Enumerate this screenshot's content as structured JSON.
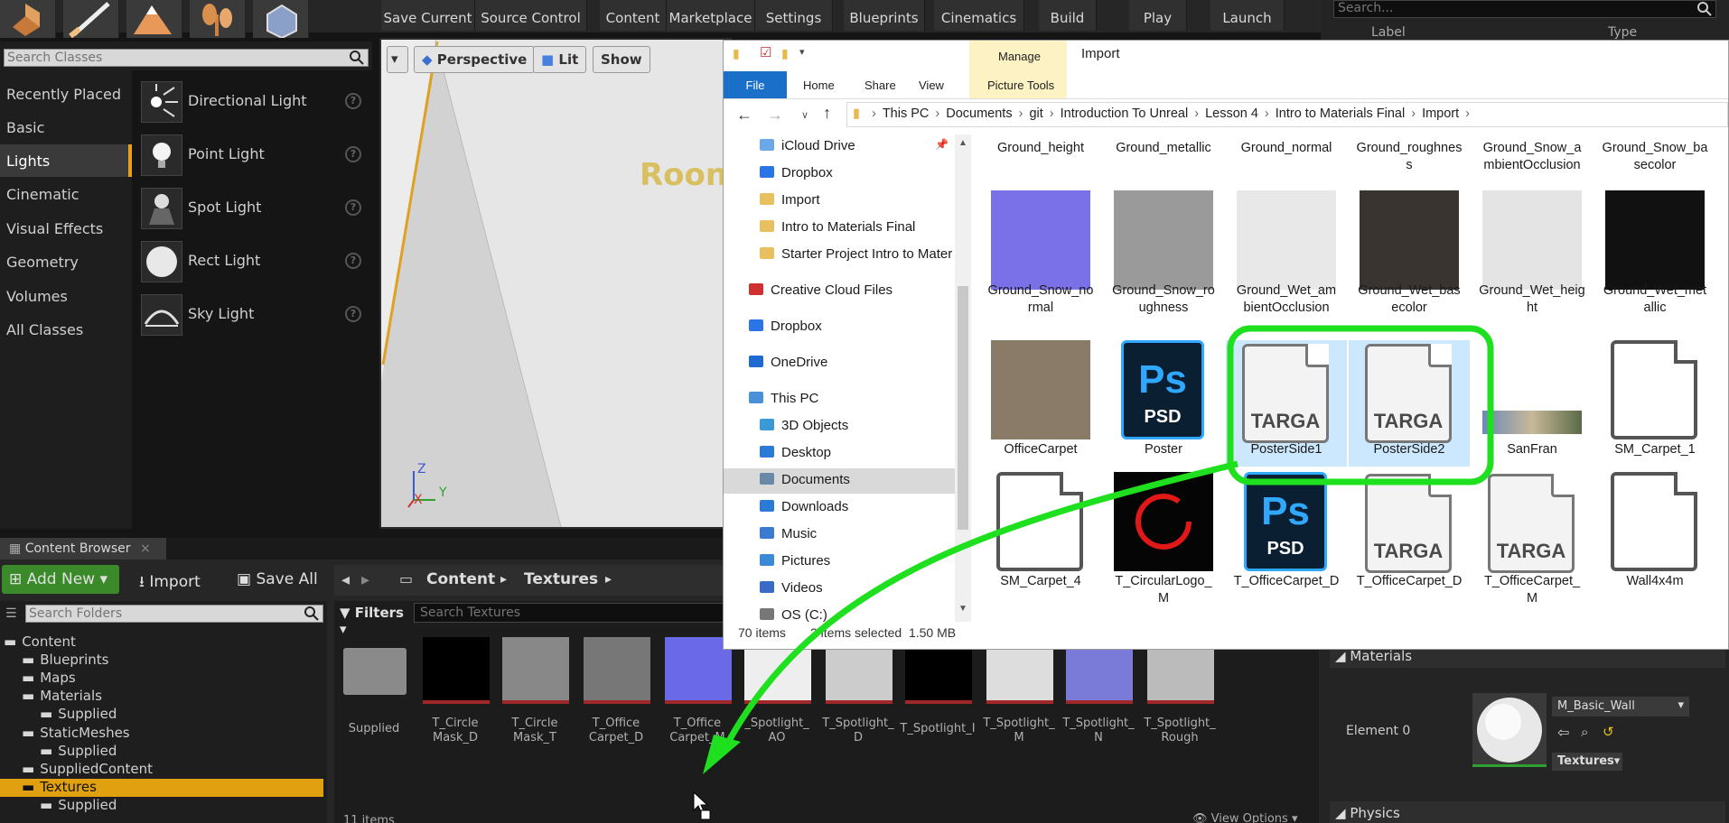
{
  "ue": {
    "toolbar": {
      "buttons": [
        "Save Current",
        "Source Control",
        "Content",
        "Marketplace",
        "Settings",
        "Blueprints",
        "Cinematics",
        "Build",
        "Play",
        "Launch"
      ]
    },
    "modes": {
      "search_placeholder": "Search Classes",
      "categories": [
        "Recently Placed",
        "Basic",
        "Lights",
        "Cinematic",
        "Visual Effects",
        "Geometry",
        "Volumes",
        "All Classes"
      ],
      "selected_category": "Lights",
      "lights": [
        "Directional Light",
        "Point Light",
        "Spot Light",
        "Rect Light",
        "Sky Light"
      ]
    },
    "viewport": {
      "perspective": "Perspective",
      "lit": "Lit",
      "show": "Show",
      "sign_text": "Roon",
      "axis_z": "Z",
      "axis_x": "X",
      "axis_y": "Y"
    },
    "content_browser": {
      "tab": "Content Browser",
      "add_new": "Add New",
      "import": "Import",
      "save_all": "Save All",
      "path": [
        "Content",
        "Textures"
      ],
      "search_folders_placeholder": "Search Folders",
      "filters": "Filters",
      "search_textures_placeholder": "Search Textures",
      "tree": [
        {
          "label": "Content",
          "depth": 0
        },
        {
          "label": "Blueprints",
          "depth": 1
        },
        {
          "label": "Maps",
          "depth": 1
        },
        {
          "label": "Materials",
          "depth": 1
        },
        {
          "label": "Supplied",
          "depth": 2
        },
        {
          "label": "StaticMeshes",
          "depth": 1
        },
        {
          "label": "Supplied",
          "depth": 2
        },
        {
          "label": "SuppliedContent",
          "depth": 1
        },
        {
          "label": "Textures",
          "depth": 1
        },
        {
          "label": "Supplied",
          "depth": 2
        }
      ],
      "selected_folder": "Textures",
      "assets": [
        "Supplied",
        "T_Circle\nMask_D",
        "T_Circle\nMask_T",
        "T_Office\nCarpet_D",
        "T_Office\nCarpet_M",
        "_Spotlight_\nAO",
        "T_Spotlight_\nD",
        "T_Spotlight_I",
        "T_Spotlight_\nM",
        "T_Spotlight_\nN",
        "T_Spotlight_\nRough"
      ],
      "item_count": "11 items",
      "view_options": "View Options"
    },
    "details": {
      "search_placeholder": "Search...",
      "col_label": "Label",
      "col_type": "Type",
      "materials_header": "Materials",
      "element_label": "Element 0",
      "material_name": "M_Basic_Wall",
      "textures_dropdown": "Textures",
      "physics_header": "Physics"
    }
  },
  "explorer": {
    "ribbon": {
      "manage": "Manage",
      "title": "Import",
      "tabs": [
        "File",
        "Home",
        "Share",
        "View"
      ],
      "picture_tools": "Picture Tools"
    },
    "breadcrumb": [
      "This PC",
      "Documents",
      "git",
      "Introduction To Unreal",
      "Lesson 4",
      "Intro to Materials Final",
      "Import"
    ],
    "nav": [
      {
        "label": "iCloud Drive",
        "indent": 1,
        "icon": "cloud-icon"
      },
      {
        "label": "Dropbox",
        "indent": 1,
        "icon": "dropbox-icon"
      },
      {
        "label": "Import",
        "indent": 1,
        "icon": "folder-icon"
      },
      {
        "label": "Intro to Materials Final",
        "indent": 1,
        "icon": "folder-icon"
      },
      {
        "label": "Starter Project Intro to Mater",
        "indent": 1,
        "icon": "folder-icon"
      },
      {
        "label": "Creative Cloud Files",
        "indent": 0,
        "icon": "creative-cloud-icon"
      },
      {
        "label": "Dropbox",
        "indent": 0,
        "icon": "dropbox-icon"
      },
      {
        "label": "OneDrive",
        "indent": 0,
        "icon": "onedrive-icon"
      },
      {
        "label": "This PC",
        "indent": 0,
        "icon": "pc-icon"
      },
      {
        "label": "3D Objects",
        "indent": 1,
        "icon": "3d-objects-icon"
      },
      {
        "label": "Desktop",
        "indent": 1,
        "icon": "desktop-icon"
      },
      {
        "label": "Documents",
        "indent": 1,
        "icon": "documents-icon"
      },
      {
        "label": "Downloads",
        "indent": 1,
        "icon": "downloads-icon"
      },
      {
        "label": "Music",
        "indent": 1,
        "icon": "music-icon"
      },
      {
        "label": "Pictures",
        "indent": 1,
        "icon": "pictures-icon"
      },
      {
        "label": "Videos",
        "indent": 1,
        "icon": "videos-icon"
      },
      {
        "label": "OS (C:)",
        "indent": 1,
        "icon": "drive-icon"
      }
    ],
    "selected_nav": "Documents",
    "top_row": [
      "Ground_height",
      "Ground_metallic",
      "Ground_normal",
      "Ground_roughnes\ns",
      "Ground_Snow_a\nmbientOcclusion",
      "Ground_Snow_ba\nsecolor"
    ],
    "row2": [
      "Ground_Snow_no\nrmal",
      "Ground_Snow_ro\nughness",
      "Ground_Wet_am\nbientOcclusion",
      "Ground_Wet_bas\necolor",
      "Ground_Wet_heig\nht",
      "Ground_Wet_met\nallic"
    ],
    "row3": [
      "OfficeCarpet",
      "Poster",
      "PosterSide1",
      "PosterSide2",
      "SanFran",
      "SM_Carpet_1"
    ],
    "row4": [
      "SM_Carpet_4",
      "T_CircularLogo_\nM",
      "T_OfficeCarpet_D",
      "T_OfficeCarpet_D",
      "T_OfficeCarpet_\nM",
      "Wall4x4m"
    ],
    "targa_label": "TARGA",
    "psd_top": "Ps",
    "psd_label": "PSD",
    "status_count": "70 items",
    "status_selected": "2 items selected  1.50 MB"
  },
  "colors": {
    "highlight": "#00e000",
    "ue_accent": "#e8a018",
    "selection": "#cce8ff"
  }
}
